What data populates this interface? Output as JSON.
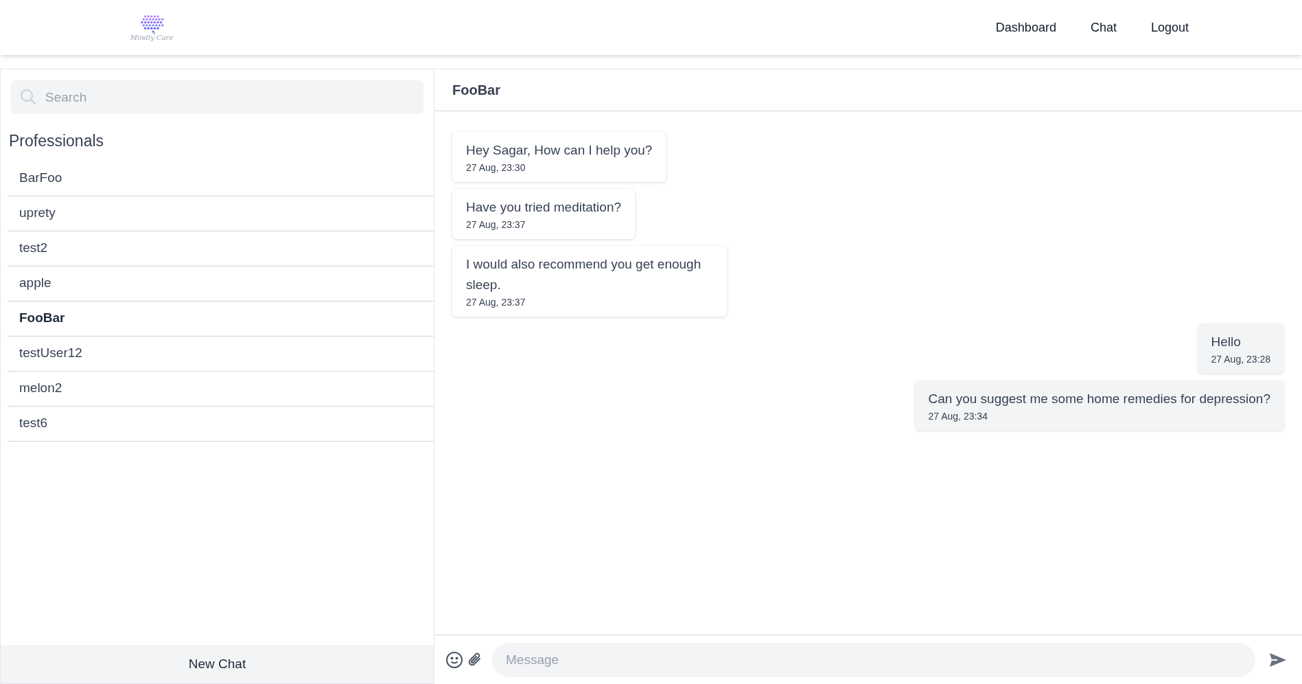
{
  "header": {
    "logo_text": "Mindly Care",
    "nav": [
      {
        "label": "Dashboard"
      },
      {
        "label": "Chat"
      },
      {
        "label": "Logout"
      }
    ]
  },
  "sidebar": {
    "search": {
      "placeholder": "Search"
    },
    "heading": "Professionals",
    "contacts": [
      {
        "name": "BarFoo",
        "selected": false
      },
      {
        "name": "uprety",
        "selected": false
      },
      {
        "name": "test2",
        "selected": false
      },
      {
        "name": "apple",
        "selected": false
      },
      {
        "name": "FooBar",
        "selected": true
      },
      {
        "name": "testUser12",
        "selected": false
      },
      {
        "name": "melon2",
        "selected": false
      },
      {
        "name": "test6",
        "selected": false
      }
    ],
    "new_chat": "New Chat"
  },
  "chat": {
    "title": "FooBar",
    "messages": [
      {
        "kind": "received",
        "text": "Hey Sagar, How can I help you?",
        "time": "27 Aug, 23:30"
      },
      {
        "kind": "received",
        "text": "Have you tried meditation?",
        "time": "27 Aug, 23:37"
      },
      {
        "kind": "received",
        "text": "I would also recommend you get enough sleep.",
        "time": "27 Aug, 23:37"
      },
      {
        "kind": "sent",
        "text": "Hello",
        "time": "27 Aug, 23:28"
      },
      {
        "kind": "sent",
        "text": "Can you suggest me some home remedies for depression?",
        "time": "27 Aug, 23:34"
      }
    ],
    "input": {
      "placeholder": "Message"
    }
  }
}
